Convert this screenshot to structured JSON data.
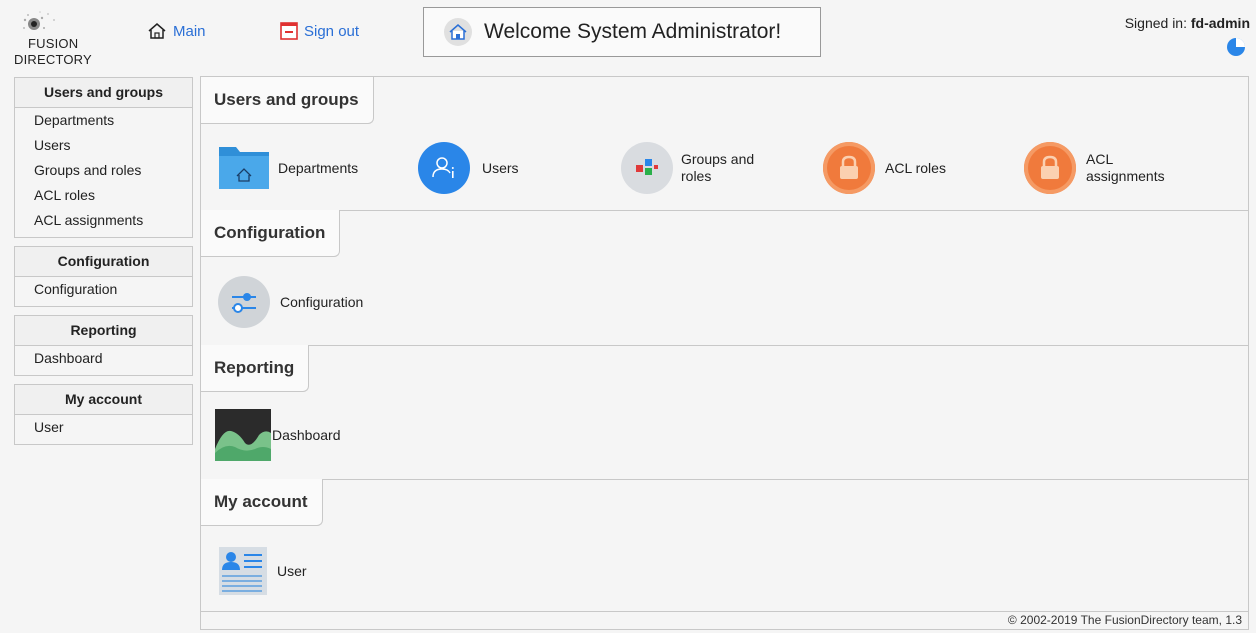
{
  "header": {
    "logo_line1": "FUSION",
    "logo_line2": "DIRECTORY",
    "main_label": "Main",
    "signout_label": "Sign out",
    "welcome_text": "Welcome System Administrator!",
    "signed_in_prefix": "Signed in: ",
    "signed_in_user": "fd-admin"
  },
  "sidebar": [
    {
      "title": "Users and groups",
      "items": [
        "Departments",
        "Users",
        "Groups and roles",
        "ACL roles",
        "ACL assignments"
      ]
    },
    {
      "title": "Configuration",
      "items": [
        "Configuration"
      ]
    },
    {
      "title": "Reporting",
      "items": [
        "Dashboard"
      ]
    },
    {
      "title": "My account",
      "items": [
        "User"
      ]
    }
  ],
  "main": {
    "sections": [
      {
        "title": "Users and groups",
        "items": [
          "Departments",
          "Users",
          "Groups and\nroles",
          "ACL roles",
          "ACL\nassignments"
        ]
      },
      {
        "title": "Configuration",
        "items": [
          "Configuration"
        ]
      },
      {
        "title": "Reporting",
        "items": [
          "Dashboard"
        ]
      },
      {
        "title": "My account",
        "items": [
          "User"
        ]
      }
    ]
  },
  "footer": "© 2002-2019 The FusionDirectory team, 1.3",
  "colors": {
    "link": "#2a6fd6",
    "acl_orange": "#f07a3c",
    "users_blue": "#2a86e8"
  }
}
